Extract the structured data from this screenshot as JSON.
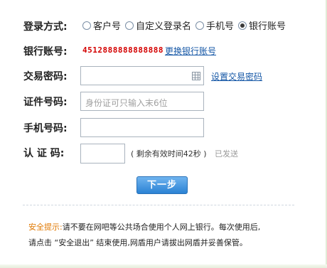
{
  "form": {
    "login_method": {
      "label": "登录方式:",
      "options": [
        {
          "label": "客户号",
          "checked": false
        },
        {
          "label": "自定义登录名",
          "checked": false
        },
        {
          "label": "手机号",
          "checked": false
        },
        {
          "label": "银行账号",
          "checked": true
        }
      ]
    },
    "bank_account": {
      "label": "银行账号:",
      "value": "4512888888888888",
      "change_link": "更换银行账号"
    },
    "trade_password": {
      "label": "交易密码:",
      "value": "",
      "keyboard_icon": "keyboard-icon",
      "set_link": "设置交易密码"
    },
    "id_number": {
      "label": "证件号码:",
      "placeholder": "身份证可只输入末6位",
      "value": ""
    },
    "phone_number": {
      "label": "手机号码:",
      "value": ""
    },
    "verify_code": {
      "label": "认 证 码:",
      "value": "",
      "countdown": "( 剩余有效时间42秒 )",
      "status": "已发送"
    },
    "submit_label": "下一步"
  },
  "security_tip": {
    "label": "安全提示:",
    "line1": "请不要在网吧等公共场合使用个人网上银行。每次使用后,",
    "line2": "请点击 “安全退出” 结束使用,网盾用户请拔出网盾并妥善保管。"
  },
  "colors": {
    "card_number": "#d40000",
    "link": "#1557a6",
    "tip_label": "#e07800",
    "button": "#2a82d4"
  }
}
